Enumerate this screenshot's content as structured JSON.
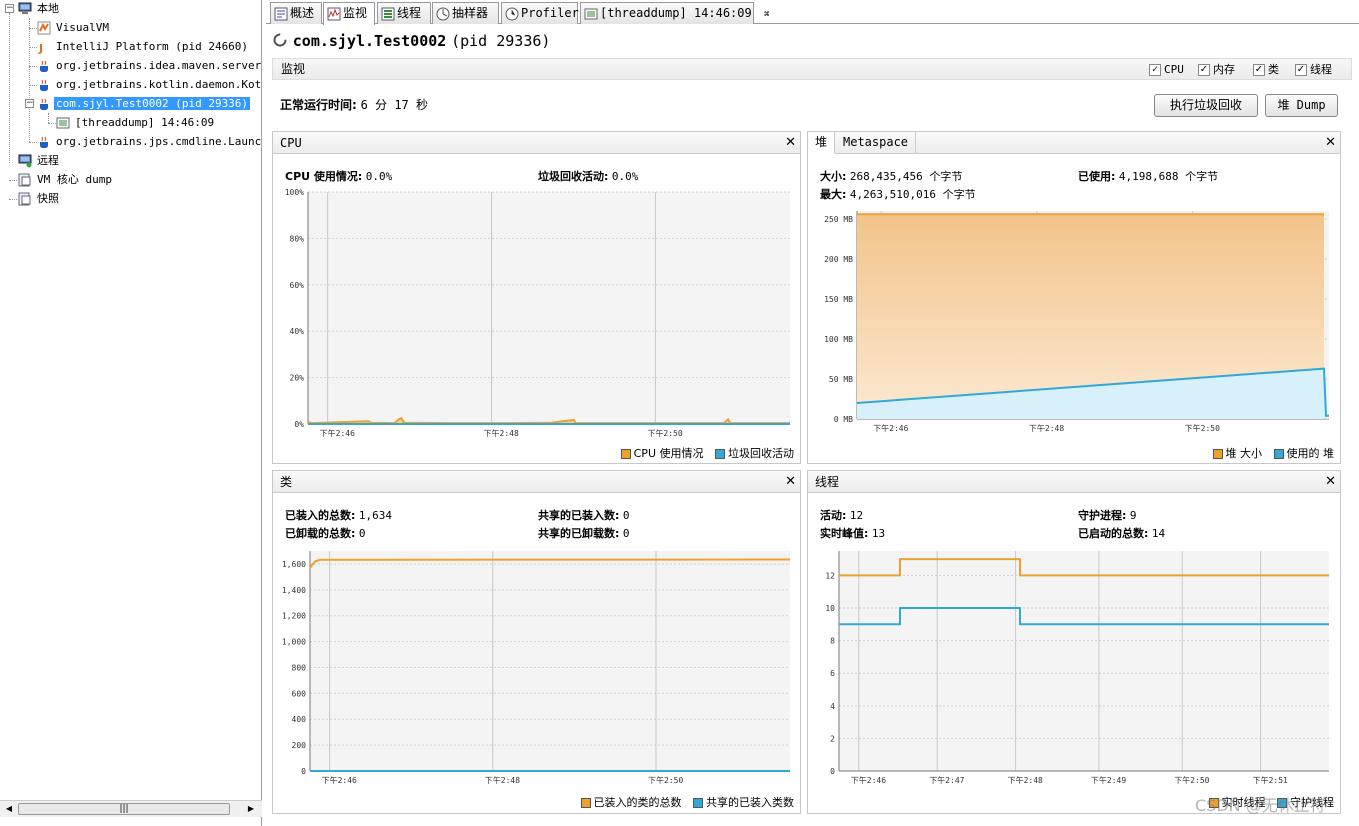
{
  "tree": {
    "local": "本地",
    "visualvm": "VisualVM",
    "intellij": "IntelliJ Platform (pid 24660)",
    "maven": "org.jetbrains.idea.maven.server.Re",
    "kotlin": "org.jetbrains.kotlin.daemon.Kotlin",
    "app": "com.sjyl.Test0002 (pid 29336)",
    "threaddump": "[threaddump] 14:46:09",
    "jps": "org.jetbrains.jps.cmdline.Launcher",
    "remote": "远程",
    "coredump": "VM 核心 dump",
    "snapshot": "快照"
  },
  "tabs": {
    "overview": "概述",
    "monitor": "监视",
    "threads": "线程",
    "sampler": "抽样器",
    "profiler": "Profiler",
    "threaddump": "[threaddump] 14:46:09",
    "close": "⌘"
  },
  "app": {
    "name": "com.sjyl.Test0002",
    "pid": "(pid 29336)"
  },
  "monitor": {
    "title": "监视",
    "cb_cpu": "CPU",
    "cb_mem": "内存",
    "cb_class": "类",
    "cb_thread": "线程",
    "uptime_label": "正常运行时间:",
    "uptime_value": "6 分 17 秒",
    "gc_button": "执行垃圾回收",
    "heapdump_button": "堆 Dump"
  },
  "cpu": {
    "title": "CPU",
    "usage_label": "CPU 使用情况:",
    "usage_value": "0.0%",
    "gc_label": "垃圾回收活动:",
    "gc_value": "0.0%",
    "legend1": "CPU 使用情况",
    "legend2": "垃圾回收活动"
  },
  "heap": {
    "tab_heap": "堆",
    "tab_meta": "Metaspace",
    "size_label": "大小:",
    "size_value": "268,435,456 个字节",
    "max_label": "最大:",
    "max_value": "4,263,510,016 个字节",
    "used_label": "已使用:",
    "used_value": "4,198,688 个字节",
    "legend1": "堆 大小",
    "legend2": "使用的 堆"
  },
  "classes": {
    "title": "类",
    "loaded_label": "已装入的总数:",
    "loaded_value": "1,634",
    "unloaded_label": "已卸载的总数:",
    "unloaded_value": "0",
    "shared_loaded_label": "共享的已装入数:",
    "shared_loaded_value": "0",
    "shared_unloaded_label": "共享的已卸载数:",
    "shared_unloaded_value": "0",
    "legend1": "已装入的类的总数",
    "legend2": "共享的已装入类数"
  },
  "threads": {
    "title": "线程",
    "live_label": "活动:",
    "live_value": "12",
    "peak_label": "实时峰值:",
    "peak_value": "13",
    "daemon_label": "守护进程:",
    "daemon_value": "9",
    "started_label": "已启动的总数:",
    "started_value": "14",
    "legend1": "实时线程",
    "legend2": "守护线程"
  },
  "watermark": "CSDN @无休止符",
  "colors": {
    "orange": "#f0a030",
    "blue": "#30a8d8"
  },
  "chart_data": [
    {
      "type": "area",
      "title": "CPU",
      "x": [
        "下午2:46",
        "下午2:48",
        "下午2:50"
      ],
      "ytick_labels": [
        "0%",
        "20%",
        "40%",
        "60%",
        "80%",
        "100%"
      ],
      "ylim": [
        0,
        100
      ],
      "series": [
        {
          "name": "CPU 使用情况",
          "color": "#f0a030",
          "points": [
            [
              0,
              1.5
            ],
            [
              0.5,
              0.5
            ],
            [
              2.5,
              0.6
            ],
            [
              3,
              0.4
            ],
            [
              60,
              1.2
            ],
            [
              62,
              0.5
            ],
            [
              85,
              0.4
            ],
            [
              90,
              2.2
            ],
            [
              92,
              2.5
            ],
            [
              95,
              0.5
            ],
            [
              140,
              0.4
            ],
            [
              200,
              0.4
            ],
            [
              240,
              0.5
            ],
            [
              262,
              1.8
            ],
            [
              264,
              0.4
            ],
            [
              300,
              0.4
            ],
            [
              360,
              0.4
            ],
            [
              410,
              0.4
            ],
            [
              414,
              2
            ],
            [
              416,
              0.4
            ],
            [
              475,
              0.4
            ]
          ]
        },
        {
          "name": "垃圾回收活动",
          "color": "#30a8d8",
          "points": [
            [
              0,
              0
            ],
            [
              475,
              0
            ]
          ]
        }
      ]
    },
    {
      "type": "area",
      "title": "堆",
      "x": [
        "下午2:46",
        "下午2:48",
        "下午2:50"
      ],
      "ytick_labels": [
        "0 MB",
        "50 MB",
        "100 MB",
        "150 MB",
        "200 MB",
        "250 MB"
      ],
      "ylim": [
        0,
        260
      ],
      "series": [
        {
          "name": "堆 大小",
          "color": "#f0a030",
          "points": [
            [
              0,
              256
            ],
            [
              470,
              256
            ]
          ]
        },
        {
          "name": "使用的 堆",
          "color": "#30a8d8",
          "points": [
            [
              0,
              20
            ],
            [
              470,
              63
            ],
            [
              472,
              4
            ],
            [
              475,
              4
            ]
          ]
        }
      ]
    },
    {
      "type": "line",
      "title": "类",
      "x": [
        "下午2:46",
        "下午2:48",
        "下午2:50"
      ],
      "ytick_labels": [
        "0",
        "200",
        "400",
        "600",
        "800",
        "1,000",
        "1,200",
        "1,400",
        "1,600"
      ],
      "ylim": [
        0,
        1700
      ],
      "series": [
        {
          "name": "已装入的类的总数",
          "color": "#f0a030",
          "points": [
            [
              0,
              1570
            ],
            [
              5,
              1620
            ],
            [
              10,
              1632
            ],
            [
              475,
              1634
            ]
          ]
        },
        {
          "name": "共享的已装入类数",
          "color": "#30a8d8",
          "points": [
            [
              0,
              0
            ],
            [
              475,
              0
            ]
          ]
        }
      ]
    },
    {
      "type": "line",
      "title": "线程",
      "x": [
        "下午2:46",
        "下午2:47",
        "下午2:48",
        "下午2:49",
        "下午2:50",
        "下午2:51"
      ],
      "ytick_labels": [
        "0",
        "2",
        "4",
        "6",
        "8",
        "10",
        "12"
      ],
      "ylim": [
        0,
        13.5
      ],
      "series": [
        {
          "name": "实时线程",
          "color": "#f0a030",
          "points": [
            [
              0,
              12
            ],
            [
              62,
              12
            ],
            [
              62,
              13
            ],
            [
              184,
              13
            ],
            [
              184,
              12
            ],
            [
              498,
              12
            ]
          ]
        },
        {
          "name": "守护线程",
          "color": "#30a8d8",
          "points": [
            [
              0,
              9
            ],
            [
              62,
              9
            ],
            [
              62,
              10
            ],
            [
              184,
              10
            ],
            [
              184,
              9
            ],
            [
              498,
              9
            ]
          ]
        }
      ]
    }
  ]
}
